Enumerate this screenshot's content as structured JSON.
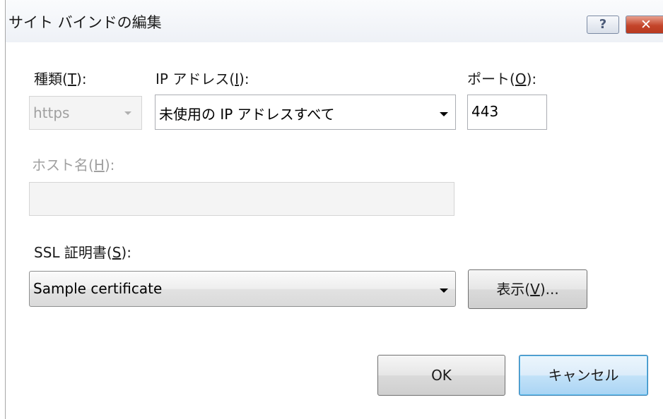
{
  "window": {
    "title": "サイト バインドの編集",
    "help_glyph": "?",
    "close_glyph": "✕"
  },
  "type_field": {
    "label_prefix": "種類(",
    "label_key": "T",
    "label_suffix": "):",
    "value": "https"
  },
  "ip_field": {
    "label_prefix": "IP アドレス(",
    "label_key": "I",
    "label_suffix": "):",
    "value": "未使用の IP アドレスすべて"
  },
  "port_field": {
    "label_prefix": "ポート(",
    "label_key": "O",
    "label_suffix": "):",
    "value": "443"
  },
  "host_field": {
    "label_prefix": "ホスト名(",
    "label_key": "H",
    "label_suffix": "):",
    "value": ""
  },
  "ssl_field": {
    "label_prefix": "SSL 証明書(",
    "label_key": "S",
    "label_suffix": "):",
    "value": "Sample certificate"
  },
  "view_button": {
    "label_prefix": "表示(",
    "label_key": "V",
    "label_suffix": ")..."
  },
  "ok_button": {
    "label": "OK"
  },
  "cancel_button": {
    "label": "キャンセル"
  }
}
